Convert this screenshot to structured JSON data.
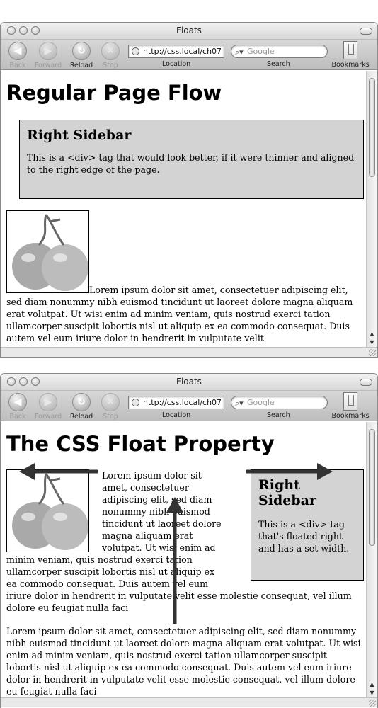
{
  "browser": {
    "title": "Floats",
    "url": "http://css.local/ch07",
    "search_placeholder": "Google",
    "buttons": {
      "back": "Back",
      "forward": "Forward",
      "reload": "Reload",
      "stop": "Stop"
    },
    "captions": {
      "location": "Location",
      "search": "Search",
      "bookmarks": "Bookmarks"
    }
  },
  "window1": {
    "heading": "Regular Page Flow",
    "sidebar_title": "Right Sidebar",
    "sidebar_text": "This is a <div> tag that would look better, if it were thinner and aligned to the right edge of the page.",
    "paragraph": "Lorem ipsum dolor sit amet, consectetuer adipiscing elit, sed diam nonummy nibh euismod tincidunt ut laoreet dolore magna aliquam erat volutpat. Ut wisi enim ad minim veniam, quis nostrud exerci tation ullamcorper suscipit lobortis nisl ut aliquip ex ea commodo consequat. Duis autem vel eum iriure dolor in hendrerit in vulputate velit"
  },
  "window2": {
    "heading": "The CSS Float Property",
    "sidebar_title": "Right Sidebar",
    "sidebar_text": "This is a <div> tag that's floated right and has a set width.",
    "paragraph1": "Lorem ipsum dolor sit amet, consectetuer adipiscing elit, sed diam nonummy nibh euismod tincidunt ut laoreet dolore magna aliquam erat volutpat. Ut wisi enim ad minim veniam, quis nostrud exerci tation ullamcorper suscipit lobortis nisl ut aliquip ex ea commodo consequat. Duis autem vel eum iriure dolor in hendrerit in vulputate velit esse molestie consequat, vel illum dolore eu feugiat nulla faci",
    "paragraph2": "Lorem ipsum dolor sit amet, consectetuer adipiscing elit, sed diam nonummy nibh euismod tincidunt ut laoreet dolore magna aliquam erat volutpat. Ut wisi enim ad minim veniam, quis nostrud exerci tation ullamcorper suscipit lobortis nisl ut aliquip ex ea commodo consequat. Duis autem vel eum iriure dolor in hendrerit in vulputate velit esse molestie consequat, vel illum dolore eu feugiat nulla faci"
  },
  "icons": {
    "back": "back-arrow-icon",
    "forward": "forward-arrow-icon",
    "reload": "reload-icon",
    "stop": "stop-icon",
    "site": "site-globe-icon",
    "search": "magnifier-icon",
    "bookmarks": "bookmarks-book-icon",
    "image": "tomato-photo"
  }
}
